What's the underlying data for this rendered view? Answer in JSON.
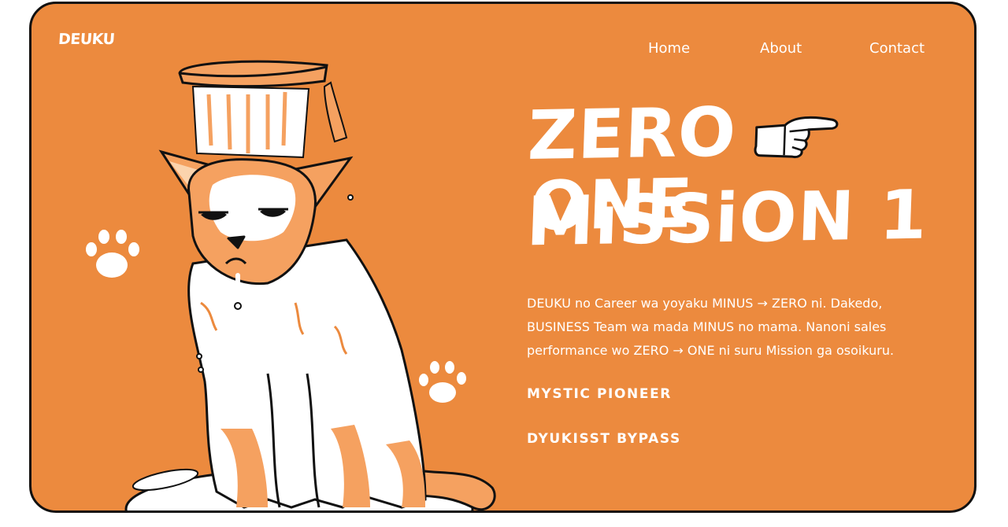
{
  "brand": {
    "logo_text": "DEUKU"
  },
  "nav": {
    "items": [
      {
        "label": "Home"
      },
      {
        "label": "About"
      },
      {
        "label": "Contact"
      }
    ]
  },
  "hero": {
    "headline_line1_left": "ZERO",
    "headline_line1_right": "ONE",
    "headline_line2": "MiSSiON 1",
    "pointer_icon": "pointing-hand-icon",
    "description_lines": [
      "DEUKU no Career wa yoyaku MINUS → ZERO ni. Dakedo,",
      "BUSINESS Team wa mada MINUS no mama. Nanoni  sales",
      "performance wo ZERO → ONE ni suru Mission ga osoikuru."
    ],
    "subtitle_1": "MYSTIC PIONEER",
    "subtitle_2": "DYUKISST BYPASS"
  },
  "illustration": {
    "main": "wet-dog-with-bucket-illustration",
    "decorations": [
      "paw-print-icon",
      "paw-print-icon"
    ]
  },
  "colors": {
    "background": "#ec8a3e",
    "text": "#ffffff",
    "outline": "#111111",
    "page": "#ffffff"
  }
}
